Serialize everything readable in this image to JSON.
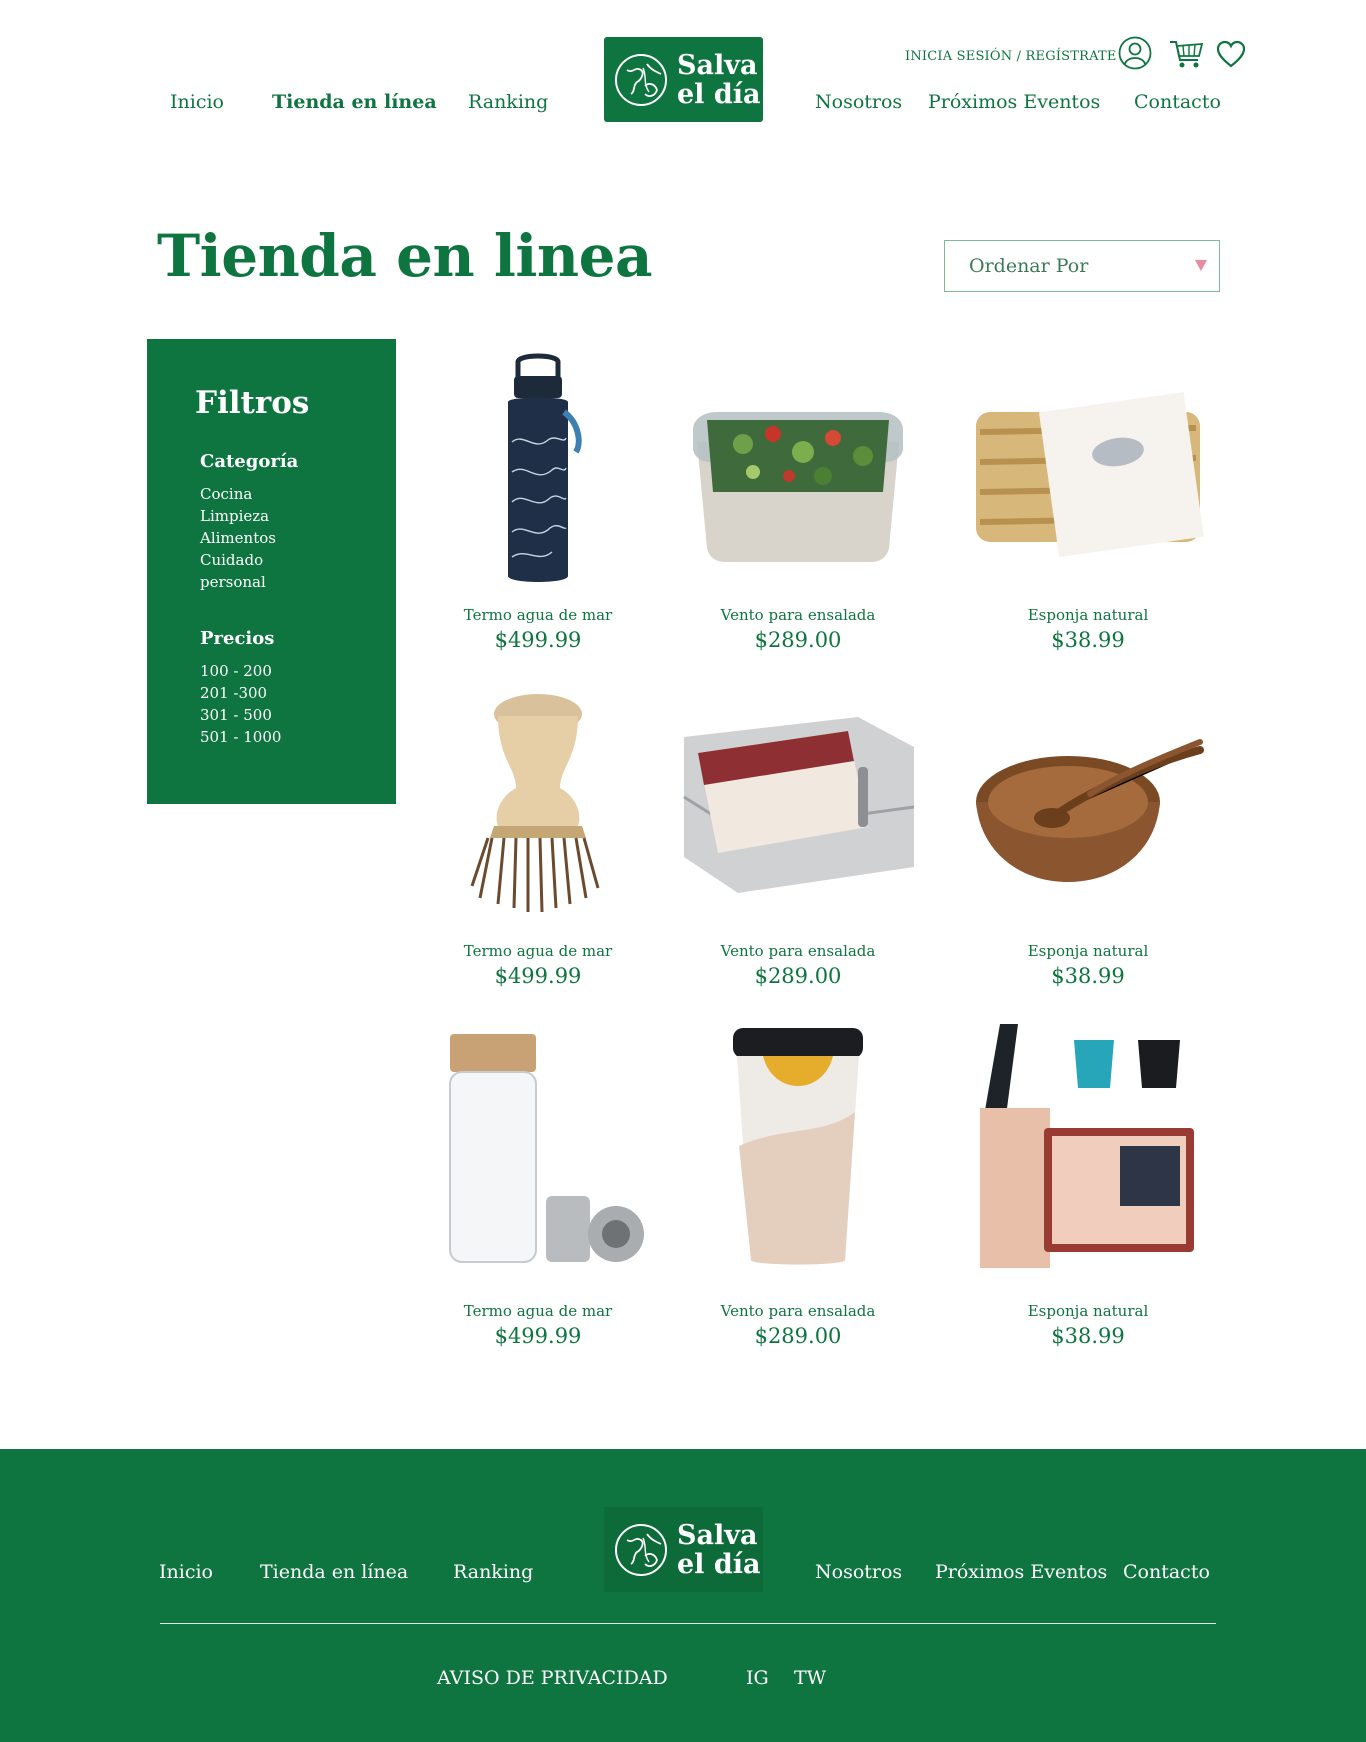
{
  "header": {
    "nav_left": [
      "Inicio",
      "Tienda en línea",
      "Ranking"
    ],
    "nav_right": [
      "Nosotros",
      "Próximos Eventos",
      "Contacto"
    ],
    "logo_line1": "Salva",
    "logo_line2": "el día",
    "auth_link": "INICIA SESIÓN / REGÍSTRATE",
    "icons": [
      "user-icon",
      "cart-icon",
      "heart-icon"
    ]
  },
  "page": {
    "title": "Tienda en linea",
    "sort_placeholder": "Ordenar Por"
  },
  "sidebar": {
    "title": "Filtros",
    "category_heading": "Categoría",
    "categories": [
      "Cocina",
      "Limpieza",
      "Alimentos",
      "Cuidado",
      "personal"
    ],
    "price_heading": "Precios",
    "prices": [
      "100 - 200",
      "201 -300",
      "301 - 500",
      "501 - 1000"
    ]
  },
  "products": [
    {
      "name": "Termo agua de mar",
      "price": "$499.99",
      "image": "water-bottle"
    },
    {
      "name": "Vento para ensalada",
      "price": "$289.00",
      "image": "salad-container"
    },
    {
      "name": "Esponja natural",
      "price": "$38.99",
      "image": "loofah-sponge"
    },
    {
      "name": "Termo agua de mar",
      "price": "$499.99",
      "image": "wooden-brush"
    },
    {
      "name": "Vento para ensalada",
      "price": "$289.00",
      "image": "steel-lunchbox"
    },
    {
      "name": "Esponja natural",
      "price": "$38.99",
      "image": "wooden-bowl"
    },
    {
      "name": "Termo agua de mar",
      "price": "$499.99",
      "image": "glass-infuser-bottle"
    },
    {
      "name": "Vento para ensalada",
      "price": "$289.00",
      "image": "ceramic-travel-cup"
    },
    {
      "name": "Esponja natural",
      "price": "$38.99",
      "image": "travel-kit"
    }
  ],
  "footer": {
    "nav_left": [
      "Inicio",
      "Tienda en línea",
      "Ranking"
    ],
    "nav_right": [
      "Nosotros",
      "Próximos Eventos",
      "Contacto"
    ],
    "logo_line1": "Salva",
    "logo_line2": "el día",
    "privacy": "AVISO DE PRIVACIDAD",
    "social": [
      "IG",
      "TW"
    ]
  },
  "colors": {
    "brand_green": "#0f7540",
    "white": "#ffffff",
    "sort_arrow": "#e88ba0"
  }
}
